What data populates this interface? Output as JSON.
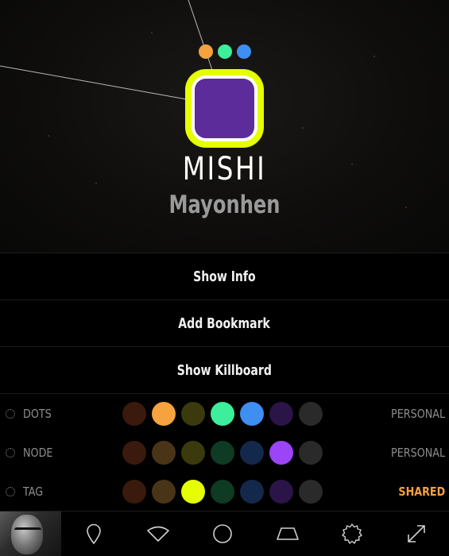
{
  "system": {
    "name": "MISHI",
    "region": "Mayonhen",
    "status_dots": [
      {
        "icon": "orange-dot",
        "color": "#f6a23f"
      },
      {
        "icon": "green-dot",
        "color": "#3dee9a"
      },
      {
        "icon": "blue-dot",
        "color": "#3f8ef2"
      }
    ],
    "node_border_color": "#e6ff00",
    "node_fill_color": "#5b2c9a"
  },
  "menu": {
    "show_info": "Show Info",
    "add_bookmark": "Add Bookmark",
    "show_killboard": "Show Killboard"
  },
  "color_rows": [
    {
      "label": "DOTS",
      "mode": "PERSONAL",
      "swatches": [
        "#3a1a0c",
        "#f6a23f",
        "#3a3a0c",
        "#3dee9a",
        "#3f8ef2",
        "#2a1448",
        "#2a2a2a"
      ],
      "selected": 1
    },
    {
      "label": "NODE",
      "mode": "PERSONAL",
      "swatches": [
        "#3a1a0c",
        "#4a3418",
        "#3a3a0c",
        "#0f3a24",
        "#13284a",
        "#9b45f7",
        "#2a2a2a"
      ],
      "selected": 5
    },
    {
      "label": "TAG",
      "mode": "SHARED",
      "swatches": [
        "#3a1a0c",
        "#4a3418",
        "#e6ff00",
        "#0f3a24",
        "#13284a",
        "#2a1448",
        "#2a2a2a"
      ],
      "selected": 2
    }
  ],
  "toolbar": {
    "icons": [
      "avatar",
      "location-pin-icon",
      "wifi-signal-icon",
      "circle-icon",
      "trapezoid-icon",
      "gear-icon",
      "expand-icon"
    ]
  }
}
